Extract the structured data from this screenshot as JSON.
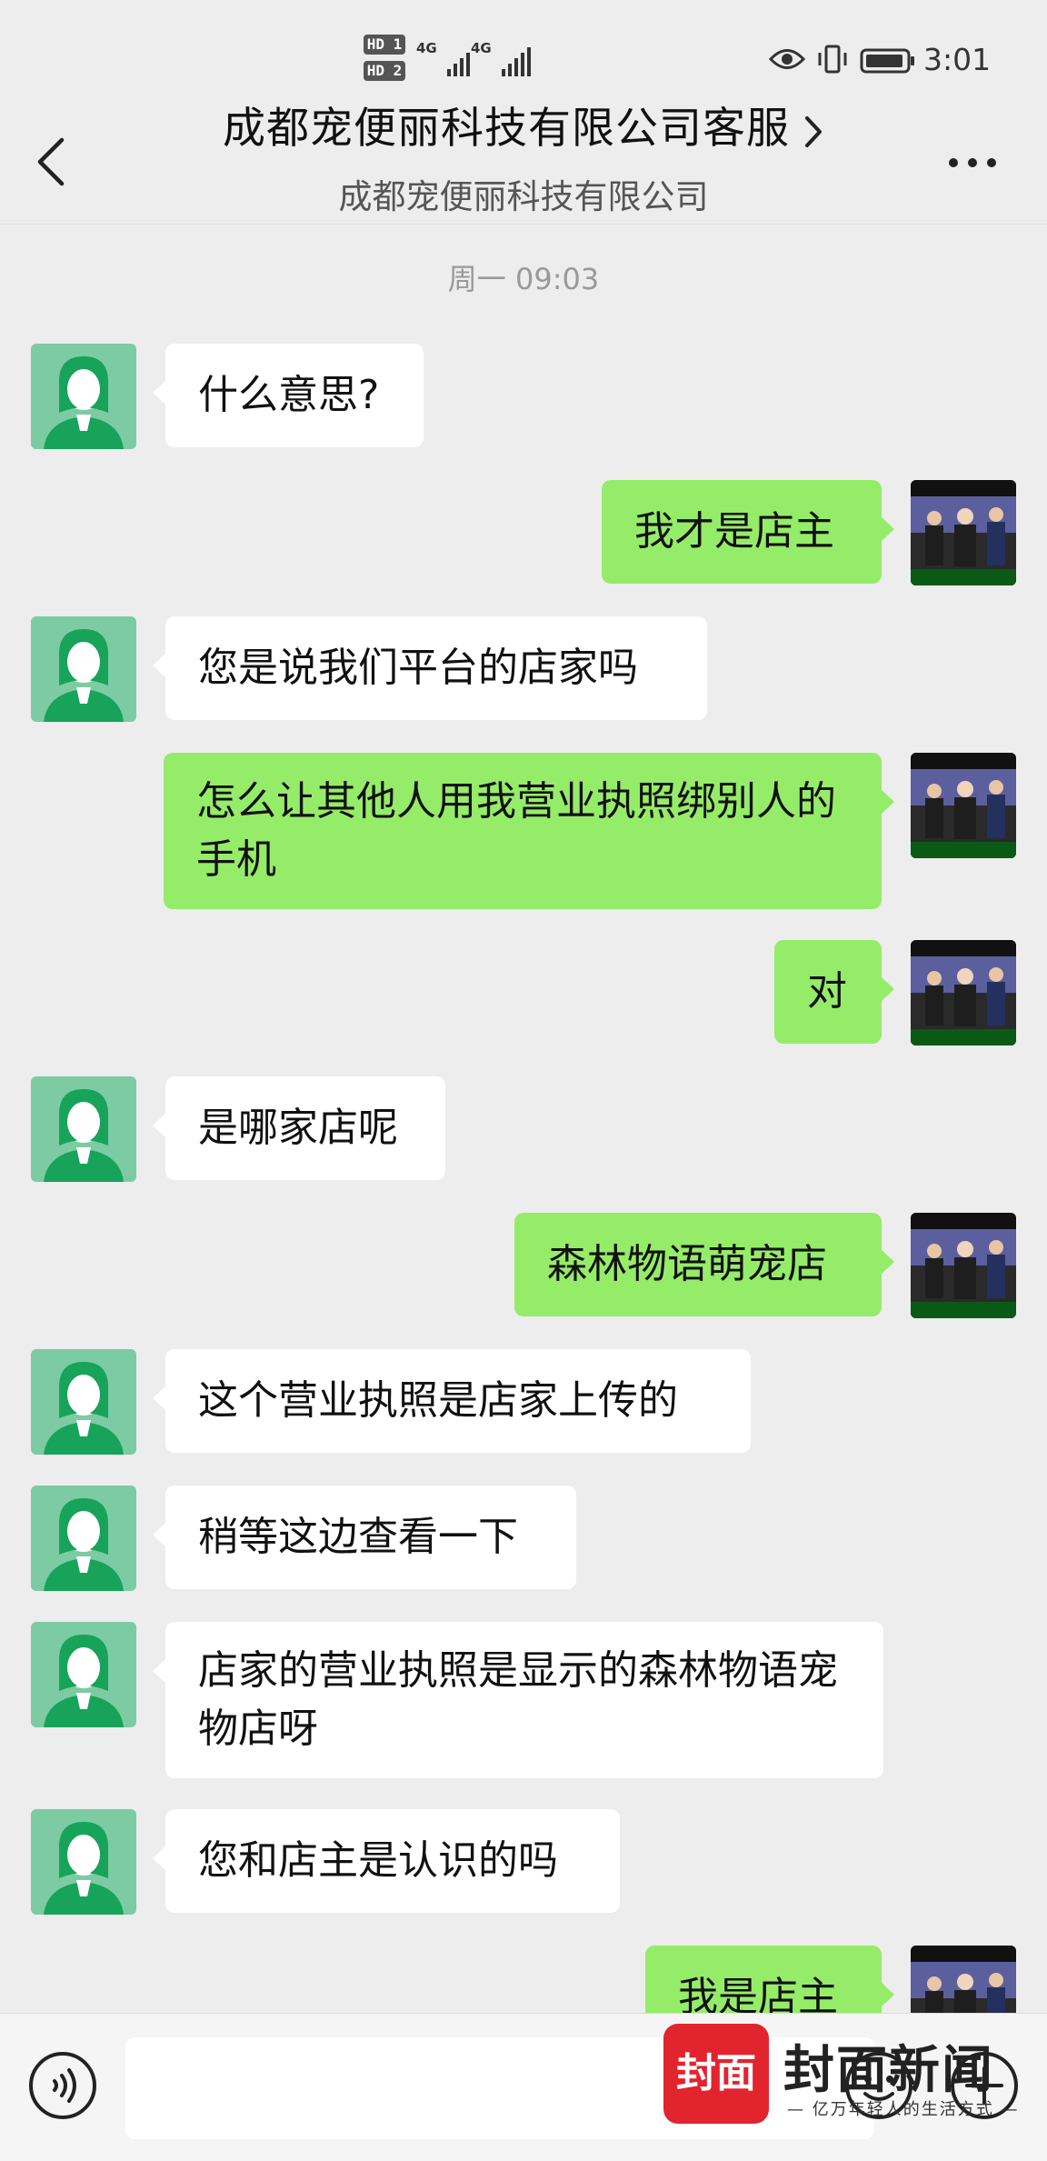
{
  "status_bar": {
    "hd1": "HD 1",
    "hd2": "HD 2",
    "net1": "4G",
    "net2": "4G",
    "time": "3:01"
  },
  "header": {
    "title": "成都宠便丽科技有限公司客服",
    "subtitle": "成都宠便丽科技有限公司"
  },
  "chat": {
    "timestamp": "周一 09:03",
    "messages": [
      {
        "from": "agent",
        "text": "什么意思?"
      },
      {
        "from": "me",
        "text": "我才是店主"
      },
      {
        "from": "agent",
        "text": "您是说我们平台的店家吗"
      },
      {
        "from": "me",
        "text": "怎么让其他人用我营业执照绑别人的手机"
      },
      {
        "from": "me",
        "text": "对"
      },
      {
        "from": "agent",
        "text": "是哪家店呢"
      },
      {
        "from": "me",
        "text": "森林物语萌宠店"
      },
      {
        "from": "agent",
        "text": "这个营业执照是店家上传的"
      },
      {
        "from": "agent",
        "text": "稍等这边查看一下"
      },
      {
        "from": "agent",
        "text": "店家的营业执照是显示的森林物语宠物店呀"
      },
      {
        "from": "agent",
        "text": "您和店主是认识的吗"
      },
      {
        "from": "me",
        "text": "我是店主"
      }
    ]
  },
  "input": {
    "placeholder": ""
  },
  "watermark": {
    "logo": "封面",
    "name": "封面新闻",
    "slogan": "— 亿万年轻人的生活方式 —"
  },
  "colors": {
    "background": "#ededed",
    "incoming_bubble": "#ffffff",
    "outgoing_bubble": "#95ec69",
    "agent_avatar": "#7ccba3",
    "watermark_red": "#e2242f"
  },
  "icons": {
    "back": "chevron-left-icon",
    "title_chevron": "chevron-right-icon",
    "more": "more-dots-icon",
    "voice": "voice-icon",
    "emoji": "emoji-icon",
    "plus": "plus-icon"
  }
}
